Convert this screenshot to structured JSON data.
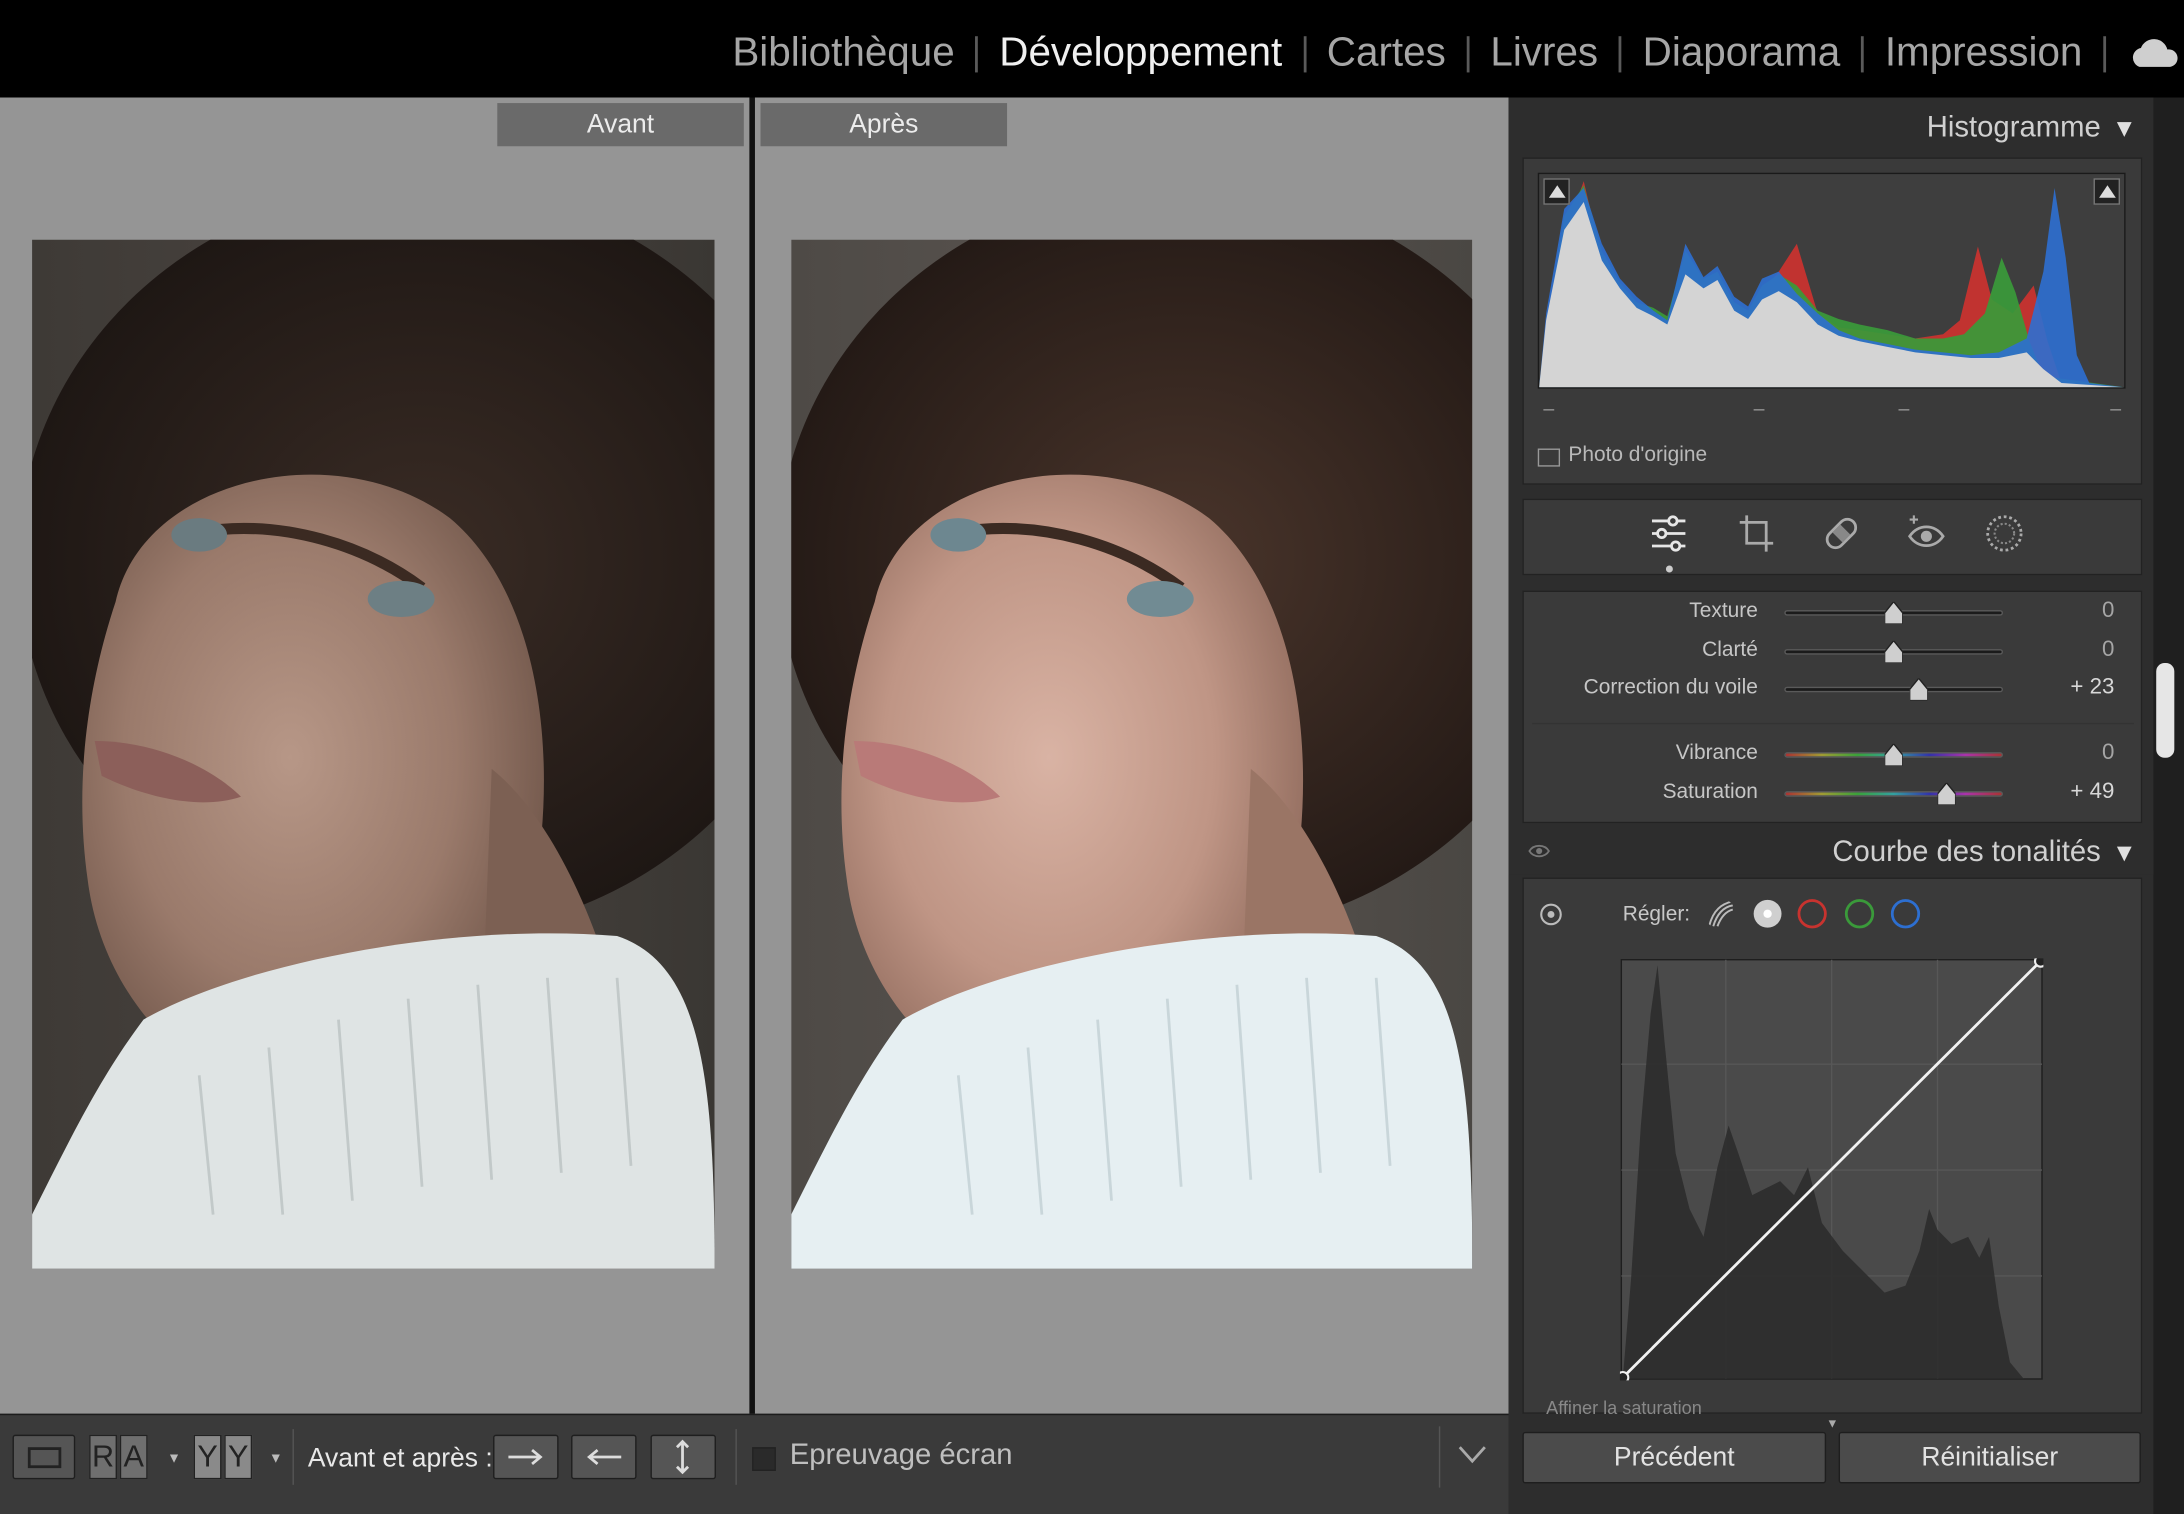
{
  "modules": {
    "library": "Bibliothèque",
    "develop": "Développement",
    "map": "Cartes",
    "book": "Livres",
    "slideshow": "Diaporama",
    "print": "Impression",
    "active": "develop",
    "cloud_icon": "cloud-icon"
  },
  "view": {
    "before_label": "Avant",
    "after_label": "Après"
  },
  "toolbar": {
    "view_single_icon": "loupe-view-icon",
    "ra_toggle": [
      "R",
      "A"
    ],
    "yy_toggle": [
      "Y",
      "Y"
    ],
    "before_after_label": "Avant et après :",
    "copy_after_icon": "copy-before-to-after-icon",
    "copy_before_icon": "copy-after-to-before-icon",
    "swap_icon": "swap-icon",
    "soft_proof_label": "Epreuvage écran",
    "soft_proof_checked": false
  },
  "histogram": {
    "title": "Histogramme",
    "show_original_label": "Photo d'origine",
    "dashes": [
      "–",
      "–",
      "–",
      "–"
    ]
  },
  "tools": [
    "edit-sliders-icon",
    "crop-icon",
    "healing-icon",
    "red-eye-icon",
    "masking-icon"
  ],
  "basic": {
    "sliders": [
      {
        "label": "Texture",
        "value": "0",
        "pos": 0.5
      },
      {
        "label": "Clarté",
        "value": "0",
        "pos": 0.5
      },
      {
        "label": "Correction du voile",
        "value": "+ 23",
        "pos": 0.615
      },
      {
        "label": "Vibrance",
        "value": "0",
        "pos": 0.5
      },
      {
        "label": "Saturation",
        "value": "+ 49",
        "pos": 0.745
      }
    ]
  },
  "curve": {
    "title": "Courbe des tonalités",
    "adjust_label": "Régler:",
    "refine_label": "Affiner la saturation",
    "channels": [
      "parametric",
      "rgb",
      "red",
      "green",
      "blue"
    ]
  },
  "buttons": {
    "previous": "Précédent",
    "reset": "Réinitialiser"
  },
  "colors": {
    "red": "#c8332f",
    "green": "#3a9a3a",
    "blue": "#2d6fd1"
  }
}
